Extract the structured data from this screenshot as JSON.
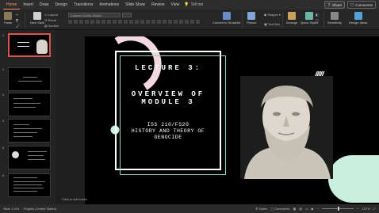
{
  "menu": {
    "tabs": [
      "Home",
      "Insert",
      "Draw",
      "Design",
      "Transitions",
      "Animations",
      "Slide Show",
      "Review",
      "View"
    ],
    "active_tab": "Home",
    "tell_me": "Tell me",
    "share": "Share",
    "comments": "Comments"
  },
  "ribbon": {
    "paste": "Paste",
    "new_slide": "New Slide",
    "layout": "Layout",
    "reset": "Reset",
    "section": "Section",
    "font_placeholder": "Century Gothic (Body)",
    "convert": "Convert to SmartArt",
    "picture": "Picture",
    "shapes": "Shapes",
    "text_box": "Text Box",
    "arrange": "Arrange",
    "quick_styles": "Quick Styles",
    "sensitivity": "Sensitivity",
    "design_ideas": "Design Ideas"
  },
  "thumbs": [
    1,
    2,
    3,
    4,
    5,
    6
  ],
  "slide": {
    "line1": "LECTURE 3:",
    "line2a": "OVERVIEW OF",
    "line2b": "MODULE 3",
    "line3a": "ISS 210/FS20",
    "line3b": "HISTORY AND THEORY OF",
    "line3c": "GENOCIDE",
    "hatch": "/////"
  },
  "notes_placeholder": "Click to add notes",
  "status": {
    "slide": "Slide 1 of 6",
    "language": "English (United States)",
    "notes": "Notes",
    "comments": "Comments",
    "zoom": "107%"
  },
  "colors": {
    "accent": "#ff8a6a",
    "mint": "#c9f0de",
    "pink": "#f6d8e0"
  }
}
